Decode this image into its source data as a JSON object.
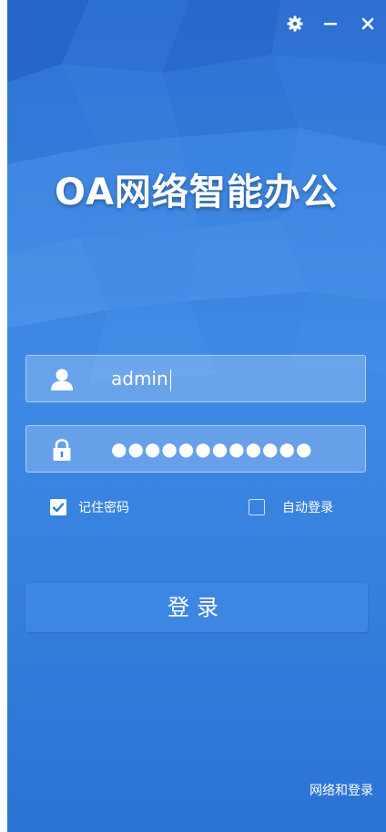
{
  "window": {
    "title": "OA网络智能办公",
    "controls": {
      "settings_icon": "gear-icon",
      "minimize_icon": "minimize-icon",
      "close_icon": "close-icon"
    }
  },
  "login_form": {
    "username": {
      "value": "admin",
      "icon": "user-icon"
    },
    "password": {
      "masked_value": "●●●●●●●●●●●●",
      "icon": "lock-icon"
    },
    "remember_password": {
      "label": "记住密码",
      "checked": true
    },
    "auto_login": {
      "label": "自动登录",
      "checked": false
    },
    "submit_label": "登录"
  },
  "footer": {
    "network_link": "网络和登录"
  },
  "colors": {
    "background": "#2f78d6",
    "button": "#3d87e3",
    "checkbox_check": "#2f78d6"
  }
}
